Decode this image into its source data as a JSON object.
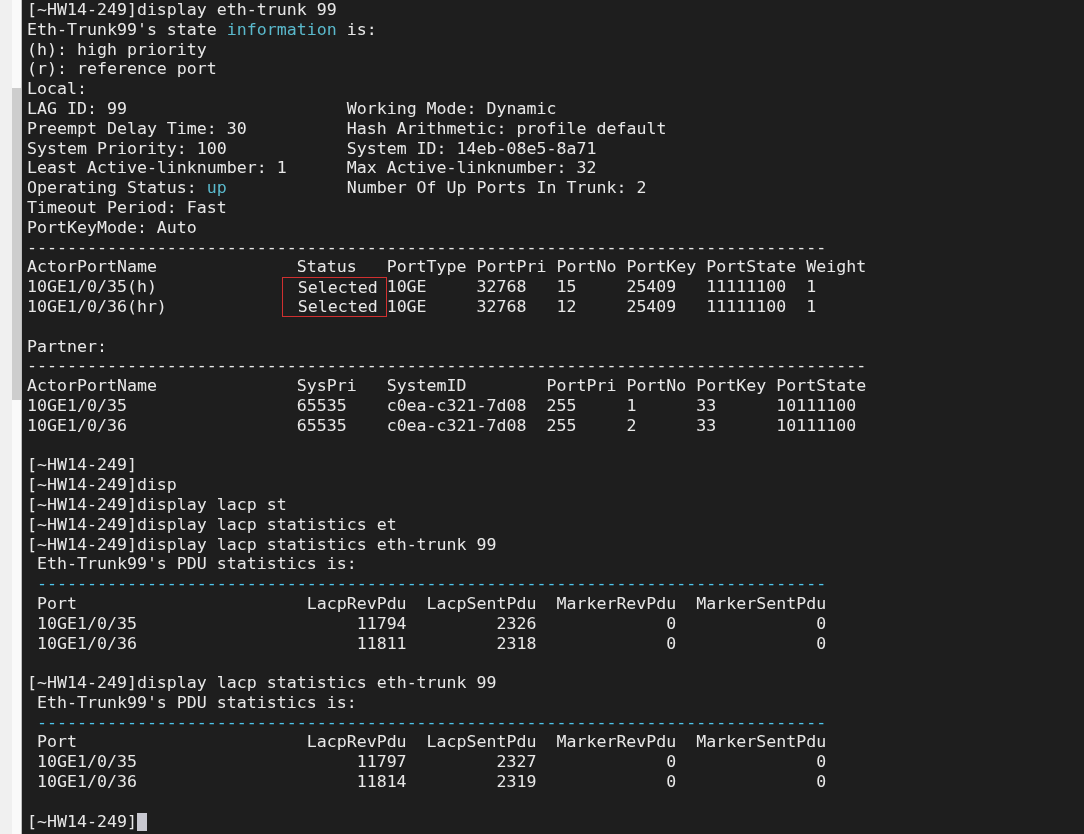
{
  "terminal": {
    "lines": [
      {
        "kind": "text",
        "text": "[~HW14-249]display eth-trunk 99"
      },
      {
        "kind": "segments",
        "segments": [
          {
            "text": "Eth-Trunk99's state ",
            "highlight": false
          },
          {
            "text": "information",
            "highlight": true
          },
          {
            "text": " is:",
            "highlight": false
          }
        ]
      },
      {
        "kind": "text",
        "text": "(h): high priority"
      },
      {
        "kind": "text",
        "text": "(r): reference port"
      },
      {
        "kind": "text",
        "text": "Local:"
      },
      {
        "kind": "pair",
        "left": [
          {
            "text": "LAG ID: 99",
            "highlight": false
          }
        ],
        "right": "Working Mode: Dynamic"
      },
      {
        "kind": "pair",
        "left": [
          {
            "text": "Preempt Delay Time: 30",
            "highlight": false
          }
        ],
        "right": "Hash Arithmetic: profile default"
      },
      {
        "kind": "pair",
        "left": [
          {
            "text": "System Priority: 100",
            "highlight": false
          }
        ],
        "right": "System ID: 14eb-08e5-8a71"
      },
      {
        "kind": "pair",
        "left": [
          {
            "text": "Least Active-linknumber: 1",
            "highlight": false
          }
        ],
        "right": "Max Active-linknumber: 32"
      },
      {
        "kind": "pair",
        "left": [
          {
            "text": "Operating Status: ",
            "highlight": false
          },
          {
            "text": "up",
            "highlight": true
          }
        ],
        "right": "Number Of Up Ports In Trunk: 2"
      },
      {
        "kind": "text",
        "text": "Timeout Period: Fast"
      },
      {
        "kind": "text",
        "text": "PortKeyMode: Auto"
      },
      {
        "kind": "rule",
        "text": "--------------------------------------------------------------------------------",
        "highlight": false
      },
      {
        "kind": "local_header",
        "cells": [
          "ActorPortName",
          "Status",
          "PortType",
          "PortPri",
          "PortNo",
          "PortKey",
          "PortState",
          "Weight"
        ]
      },
      {
        "kind": "local_row",
        "highlighted": true,
        "cells": [
          "10GE1/0/35(h)",
          "Selected",
          "10GE",
          "32768",
          "15",
          "25409",
          "11111100",
          "1"
        ]
      },
      {
        "kind": "local_row",
        "highlighted": true,
        "cells": [
          "10GE1/0/36(hr)",
          "Selected",
          "10GE",
          "32768",
          "12",
          "25409",
          "11111100",
          "1"
        ]
      },
      {
        "kind": "blank"
      },
      {
        "kind": "text",
        "text": "Partner:"
      },
      {
        "kind": "rule",
        "text": "------------------------------------------------------------------------------------",
        "highlight": false
      },
      {
        "kind": "partner_header",
        "cells": [
          "ActorPortName",
          "SysPri",
          "SystemID",
          "PortPri",
          "PortNo",
          "PortKey",
          "PortState"
        ]
      },
      {
        "kind": "partner_row",
        "highlighted": false,
        "cells": [
          "10GE1/0/35",
          "65535",
          "c0ea-c321-7d08",
          "255",
          "1",
          "33",
          "10111100"
        ]
      },
      {
        "kind": "partner_row",
        "highlighted": false,
        "cells": [
          "10GE1/0/36",
          "65535",
          "c0ea-c321-7d08",
          "255",
          "2",
          "33",
          "10111100"
        ]
      },
      {
        "kind": "blank"
      },
      {
        "kind": "text",
        "text": "[~HW14-249]"
      },
      {
        "kind": "text",
        "text": "[~HW14-249]disp"
      },
      {
        "kind": "text",
        "text": "[~HW14-249]display lacp st"
      },
      {
        "kind": "text",
        "text": "[~HW14-249]display lacp statistics et"
      },
      {
        "kind": "text",
        "text": "[~HW14-249]display lacp statistics eth-trunk 99"
      },
      {
        "kind": "text",
        "text": " Eth-Trunk99's PDU statistics is:"
      },
      {
        "kind": "rule",
        "text": " -------------------------------------------------------------------------------",
        "highlight": true
      },
      {
        "kind": "pdu_header",
        "cells": [
          "Port",
          "LacpRevPdu",
          "LacpSentPdu",
          "MarkerRevPdu",
          "MarkerSentPdu"
        ]
      },
      {
        "kind": "pdu_row",
        "highlighted": false,
        "cells": [
          "10GE1/0/35",
          "11794",
          "2326",
          "0",
          "0"
        ]
      },
      {
        "kind": "pdu_row",
        "highlighted": false,
        "cells": [
          "10GE1/0/36",
          "11811",
          "2318",
          "0",
          "0"
        ]
      },
      {
        "kind": "blank"
      },
      {
        "kind": "text",
        "text": "[~HW14-249]display lacp statistics eth-trunk 99"
      },
      {
        "kind": "text",
        "text": " Eth-Trunk99's PDU statistics is:"
      },
      {
        "kind": "rule",
        "text": " -------------------------------------------------------------------------------",
        "highlight": true
      },
      {
        "kind": "pdu_header",
        "cells": [
          "Port",
          "LacpRevPdu",
          "LacpSentPdu",
          "MarkerRevPdu",
          "MarkerSentPdu"
        ]
      },
      {
        "kind": "pdu_row",
        "highlighted": false,
        "cells": [
          "10GE1/0/35",
          "11797",
          "2327",
          "0",
          "0"
        ]
      },
      {
        "kind": "pdu_row",
        "highlighted": false,
        "cells": [
          "10GE1/0/36",
          "11814",
          "2319",
          "0",
          "0"
        ]
      },
      {
        "kind": "blank"
      },
      {
        "kind": "prompt",
        "text": "[~HW14-249]"
      }
    ]
  }
}
